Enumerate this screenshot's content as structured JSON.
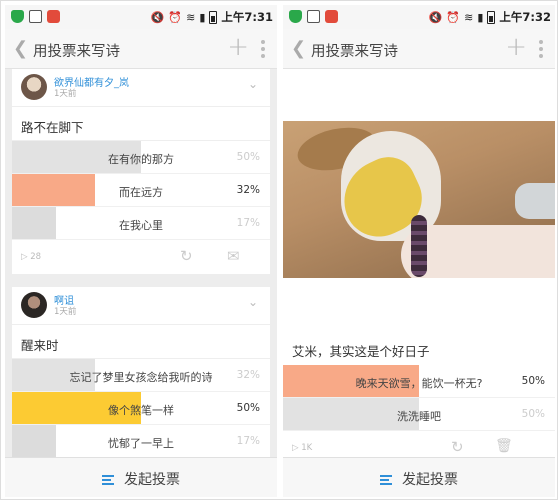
{
  "colors": {
    "accent": "#2f8fd8",
    "vote_orange": "#f8a987",
    "vote_yellow": "#fccb33",
    "vote_gray": "#dcdcdc"
  },
  "left_phone": {
    "status": {
      "time": "上午7:31"
    },
    "nav": {
      "back_icon": "chevron-left",
      "title": "用投票来写诗",
      "add_icon": "plus",
      "more_icon": "more-vertical"
    },
    "cards": [
      {
        "user": "欲界仙都有夕_岚",
        "time": "1天前",
        "question": "路不在脚下",
        "options": [
          {
            "label": "在有你的那方",
            "pct": "50%",
            "fill": 0.5,
            "color": "#e2e2e2",
            "chosen": false
          },
          {
            "label": "而在远方",
            "pct": "32%",
            "fill": 0.32,
            "color": "#f8a987",
            "chosen": true
          },
          {
            "label": "在我心里",
            "pct": "17%",
            "fill": 0.17,
            "color": "#dcdcdc",
            "chosen": false
          }
        ],
        "likes": "28"
      },
      {
        "user": "啊诅",
        "time": "1天前",
        "question": "醒来时",
        "options": [
          {
            "label": "忘记了梦里女孩念给我听的诗",
            "pct": "32%",
            "fill": 0.32,
            "color": "#e2e2e2",
            "chosen": false
          },
          {
            "label": "像个煞笔一样",
            "pct": "50%",
            "fill": 0.5,
            "color": "#fccb33",
            "chosen": true
          },
          {
            "label": "忧郁了一早上",
            "pct": "17%",
            "fill": 0.17,
            "color": "#dcdcdc",
            "chosen": false
          }
        ]
      }
    ],
    "bottom": {
      "launch_label": "发起投票"
    }
  },
  "right_phone": {
    "status": {
      "time": "上午7:32"
    },
    "nav": {
      "back_icon": "chevron-left",
      "title": "用投票来写诗",
      "add_icon": "plus",
      "more_icon": "more-vertical"
    },
    "post": {
      "question": "艾米，其实这是个好日子",
      "options": [
        {
          "label": "晚来天欲雪，能饮一杯无?",
          "pct": "50%",
          "fill": 0.5,
          "color": "#f8a987",
          "chosen": true
        },
        {
          "label": "洗洗睡吧",
          "pct": "50%",
          "fill": 0.5,
          "color": "#e2e2e2",
          "chosen": false
        }
      ],
      "likes": "1K"
    },
    "bottom": {
      "launch_label": "发起投票"
    }
  }
}
